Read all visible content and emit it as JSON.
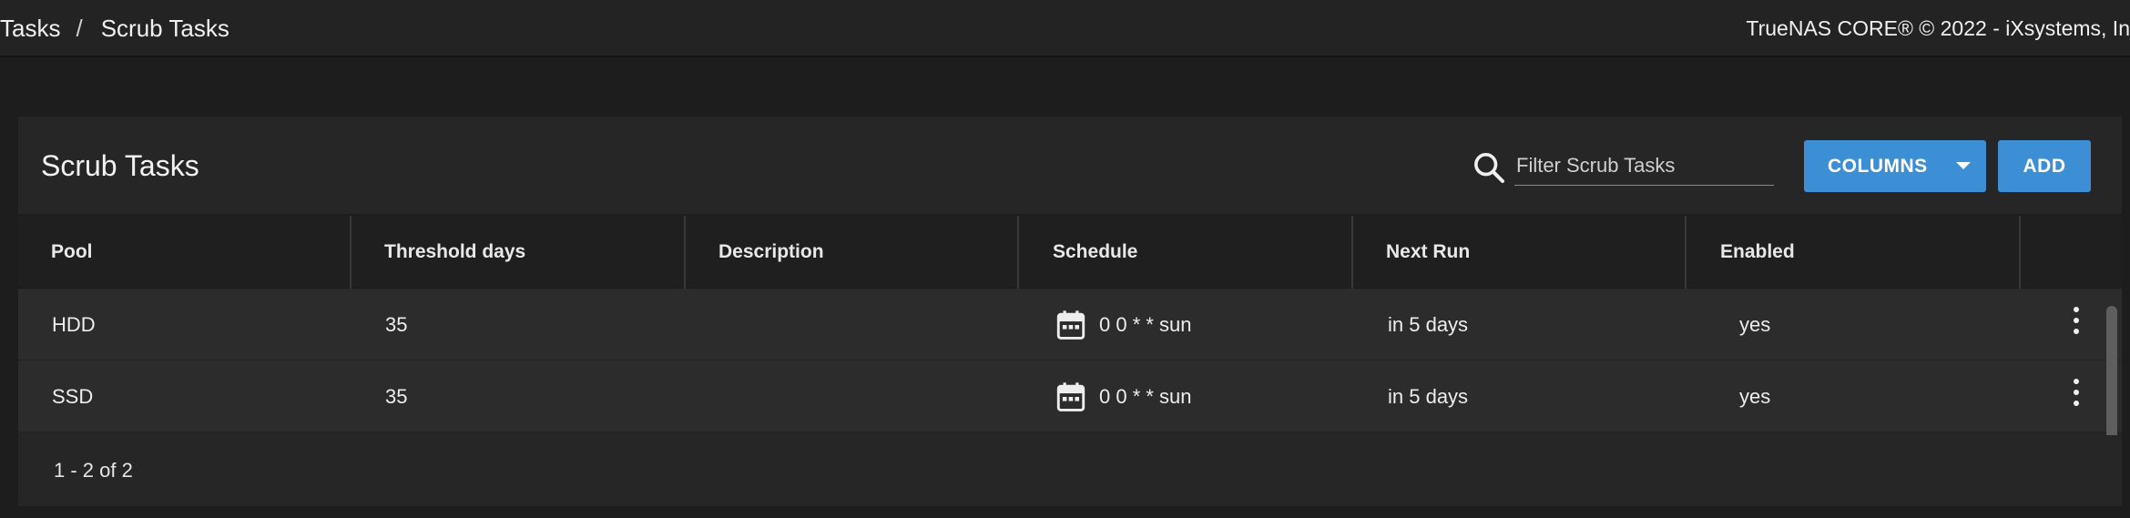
{
  "breadcrumb": {
    "parent": "Tasks",
    "separator": "/",
    "current": "Scrub Tasks"
  },
  "copyright": "TrueNAS CORE® © 2022 - iXsystems, In",
  "card": {
    "title": "Scrub Tasks",
    "search": {
      "placeholder": "Filter Scrub Tasks",
      "value": ""
    },
    "columns_label": "COLUMNS",
    "add_label": "ADD"
  },
  "table": {
    "headers": [
      "Pool",
      "Threshold days",
      "Description",
      "Schedule",
      "Next Run",
      "Enabled"
    ],
    "rows": [
      {
        "pool": "HDD",
        "threshold": "35",
        "description": "",
        "schedule": "0 0 * * sun",
        "next_run": "in 5 days",
        "enabled": "yes"
      },
      {
        "pool": "SSD",
        "threshold": "35",
        "description": "",
        "schedule": "0 0 * * sun",
        "next_run": "in 5 days",
        "enabled": "yes"
      }
    ],
    "pagination": "1 - 2 of 2"
  },
  "icons": {
    "search": "search-icon",
    "calendar": "calendar-icon",
    "menu": "more-vert-icon",
    "dropdown": "caret-down-icon"
  },
  "colors": {
    "accent": "#3c8fd4",
    "background": "#1d1d1d",
    "card": "#262626"
  }
}
